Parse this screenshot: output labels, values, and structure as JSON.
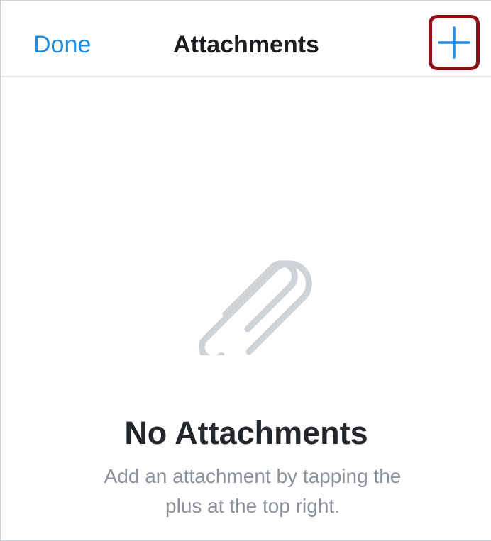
{
  "navbar": {
    "done_label": "Done",
    "title": "Attachments",
    "add_icon": "plus-icon"
  },
  "empty_state": {
    "icon": "paperclip-icon",
    "title": "No Attachments",
    "message": "Add an attachment by tapping the plus at the top right."
  },
  "colors": {
    "accent": "#1f8ce0",
    "highlight_border": "#8c1217",
    "icon_gray": "#cfd2d8",
    "title_text": "#23262b",
    "message_text": "#8a919b"
  }
}
